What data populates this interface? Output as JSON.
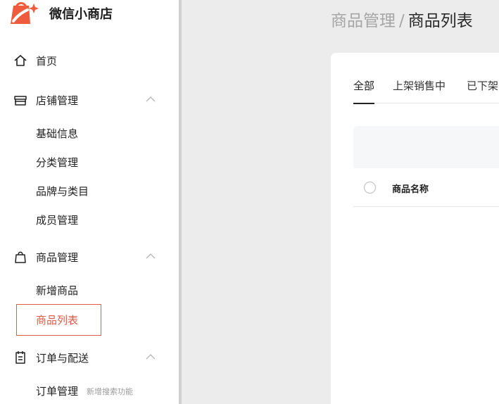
{
  "app": {
    "name": "微信小商店",
    "brand_color": "#ef5b3d"
  },
  "sidebar": {
    "items": [
      {
        "label": "首页",
        "icon": "home-icon"
      },
      {
        "label": "店铺管理",
        "icon": "store-icon",
        "expanded": true,
        "children": [
          "基础信息",
          "分类管理",
          "品牌与类目",
          "成员管理"
        ]
      },
      {
        "label": "商品管理",
        "icon": "shopping-bag-icon",
        "expanded": true,
        "children": [
          "新增商品",
          "商品列表"
        ],
        "active_child": "商品列表"
      },
      {
        "label": "订单与配送",
        "icon": "clipboard-icon",
        "expanded": true,
        "children": [
          "订单管理"
        ],
        "child_hint": "新增搜索功能"
      }
    ]
  },
  "breadcrumb": {
    "parent": "商品管理",
    "separator": "/",
    "current": "商品列表"
  },
  "tabs": [
    {
      "label": "全部",
      "active": true
    },
    {
      "label": "上架销售中",
      "active": false
    },
    {
      "label": "已下架",
      "active": false
    }
  ],
  "table": {
    "columns": [
      "商品名称"
    ]
  },
  "colors": {
    "active_accent": "#e05a47",
    "content_bg": "#ececec"
  }
}
